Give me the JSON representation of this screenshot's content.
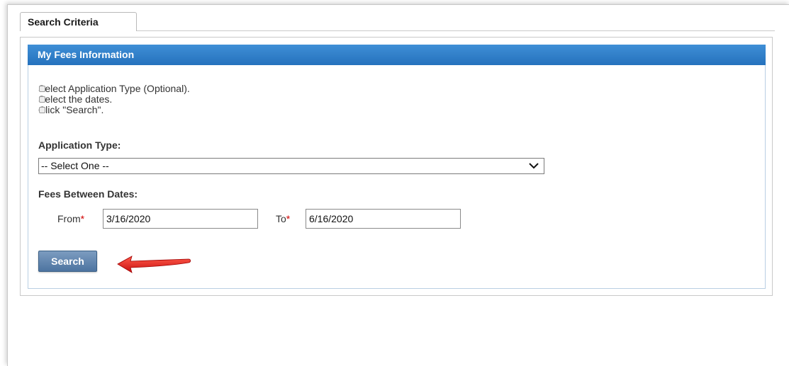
{
  "tabs": [
    {
      "label": "Search Criteria"
    }
  ],
  "panel": {
    "title": "My Fees Information"
  },
  "instructions": [
    "Select Application Type (Optional).",
    "Select the dates.",
    "Click \"Search\"."
  ],
  "application_type": {
    "label": "Application Type:",
    "selected": "-- Select One --"
  },
  "fees_between": {
    "label": "Fees Between Dates:",
    "from_label": "From",
    "from_value": "3/16/2020",
    "to_label": "To",
    "to_value": "6/16/2020",
    "required_marker": "*"
  },
  "search_button": {
    "label": "Search"
  },
  "colors": {
    "header_blue": "#2f7ec8",
    "button_blue": "#5b80aa",
    "required_red": "#d00000",
    "arrow_red": "#e02020"
  },
  "icons": {
    "dropdown": "chevron-down-icon",
    "bullet": "square-bullet-icon",
    "annotation": "red-arrow-icon"
  }
}
